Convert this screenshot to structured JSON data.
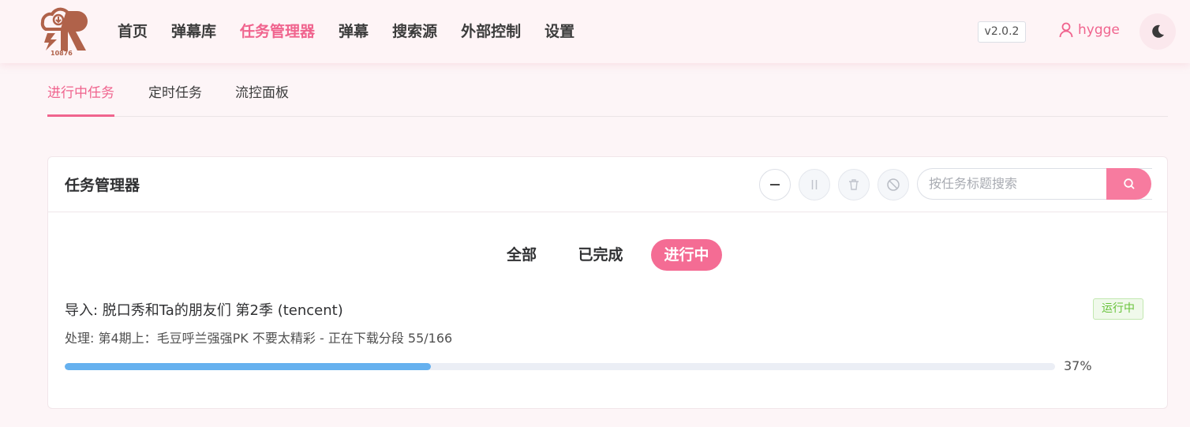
{
  "logo": {
    "number": "10876",
    "brand_color": "#b0624a"
  },
  "nav": [
    {
      "label": "首页",
      "active": false
    },
    {
      "label": "弹幕库",
      "active": false
    },
    {
      "label": "任务管理器",
      "active": true
    },
    {
      "label": "弹幕",
      "active": false
    },
    {
      "label": "搜索源",
      "active": false
    },
    {
      "label": "外部控制",
      "active": false
    },
    {
      "label": "设置",
      "active": false
    }
  ],
  "version": "v2.0.2",
  "user": {
    "name": "hygge",
    "icon": "user-icon"
  },
  "theme_toggle_icon": "moon-icon",
  "subtabs": [
    {
      "label": "进行中任务",
      "active": true
    },
    {
      "label": "定时任务",
      "active": false
    },
    {
      "label": "流控面板",
      "active": false
    }
  ],
  "card": {
    "title": "任务管理器",
    "toolbar": [
      "minus-icon",
      "pause-icon",
      "trash-icon",
      "ban-icon"
    ],
    "search": {
      "placeholder": "按任务标题搜索",
      "button_icon": "search-icon"
    }
  },
  "filters": [
    {
      "label": "全部",
      "active": false
    },
    {
      "label": "已完成",
      "active": false
    },
    {
      "label": "进行中",
      "active": true
    }
  ],
  "tasks": [
    {
      "title": "导入: 脱口秀和Ta的朋友们 第2季 (tencent)",
      "status": "运行中",
      "description": "处理: 第4期上：毛豆呼兰强强PK 不要太精彩 - 正在下载分段 55/166",
      "progress": 37,
      "progress_label": "37%"
    }
  ],
  "colors": {
    "accent": "#f0648e",
    "progress": "#66b1ef",
    "status_running": "#67c23a"
  }
}
